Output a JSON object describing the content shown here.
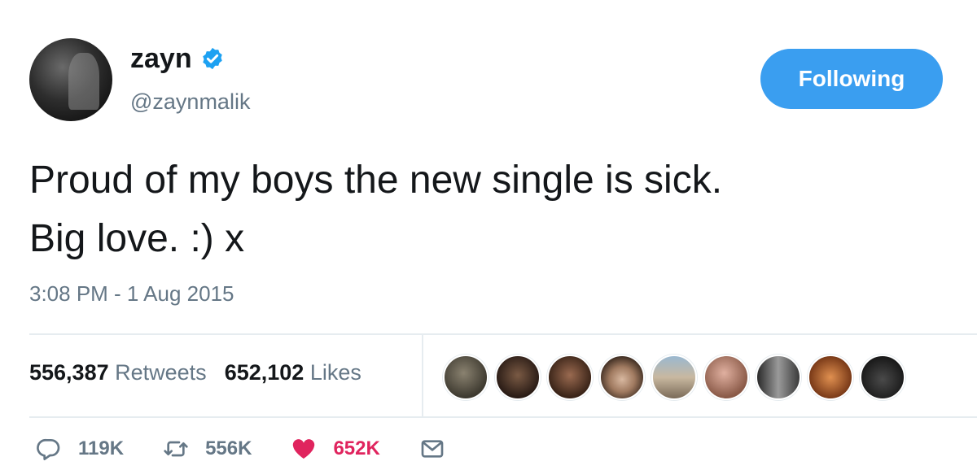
{
  "user": {
    "name": "zayn",
    "handle": "@zaynmalik",
    "follow_label": "Following",
    "verified_icon": "verified-badge-icon"
  },
  "tweet": {
    "text": "Proud of my boys the new single is sick.\nBig love. :) x",
    "timestamp": "3:08 PM - 1 Aug 2015"
  },
  "stats": {
    "retweets_count": "556,387",
    "retweets_label": "Retweets",
    "likes_count": "652,102",
    "likes_label": "Likes"
  },
  "actions": {
    "reply_count": "119K",
    "retweet_count": "556K",
    "like_count": "652K"
  },
  "colors": {
    "accent": "#3a9ef0",
    "like": "#e0245e",
    "secondary_text": "#657786"
  }
}
